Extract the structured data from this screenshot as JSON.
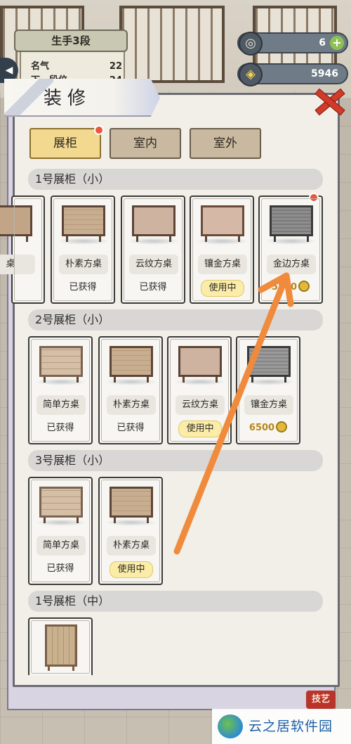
{
  "hud": {
    "rank_title": "生手3段",
    "fame_label": "名气",
    "fame_value": "22",
    "next_label": "下一段位",
    "next_value": "24",
    "currency1_value": "6",
    "currency2_value": "5946"
  },
  "panel": {
    "title": "装修",
    "close_label": "close"
  },
  "tabs": [
    {
      "label": "展柜",
      "active": true
    },
    {
      "label": "室内",
      "active": false
    },
    {
      "label": "室外",
      "active": false
    }
  ],
  "sections": [
    {
      "label": "1号展柜（小）",
      "items": [
        {
          "name": "",
          "status": "",
          "type": "partial"
        },
        {
          "name": "朴素方桌",
          "status": "已获得",
          "type": "owned"
        },
        {
          "name": "云纹方桌",
          "status": "已获得",
          "type": "owned"
        },
        {
          "name": "镶金方桌",
          "status": "使用中",
          "type": "inuse"
        },
        {
          "name": "金边方桌",
          "status": "5500",
          "type": "price"
        }
      ]
    },
    {
      "label": "2号展柜（小）",
      "items": [
        {
          "name": "简单方桌",
          "status": "已获得",
          "type": "owned"
        },
        {
          "name": "朴素方桌",
          "status": "已获得",
          "type": "owned"
        },
        {
          "name": "云纹方桌",
          "status": "使用中",
          "type": "inuse"
        },
        {
          "name": "镶金方桌",
          "status": "6500",
          "type": "price"
        }
      ]
    },
    {
      "label": "3号展柜（小）",
      "items": [
        {
          "name": "简单方桌",
          "status": "已获得",
          "type": "owned"
        },
        {
          "name": "朴素方桌",
          "status": "使用中",
          "type": "inuse"
        }
      ]
    },
    {
      "label": "1号展柜（中）",
      "items": [
        {
          "name": "",
          "status": "",
          "type": "tall"
        }
      ]
    }
  ],
  "footer": {
    "skill_badge": "技艺",
    "watermark": "云之居软件园"
  },
  "colors": {
    "accent": "#f2d98f",
    "alert_dot": "#e8573e",
    "arrow": "#f08a3c",
    "price": "#b7861d"
  }
}
